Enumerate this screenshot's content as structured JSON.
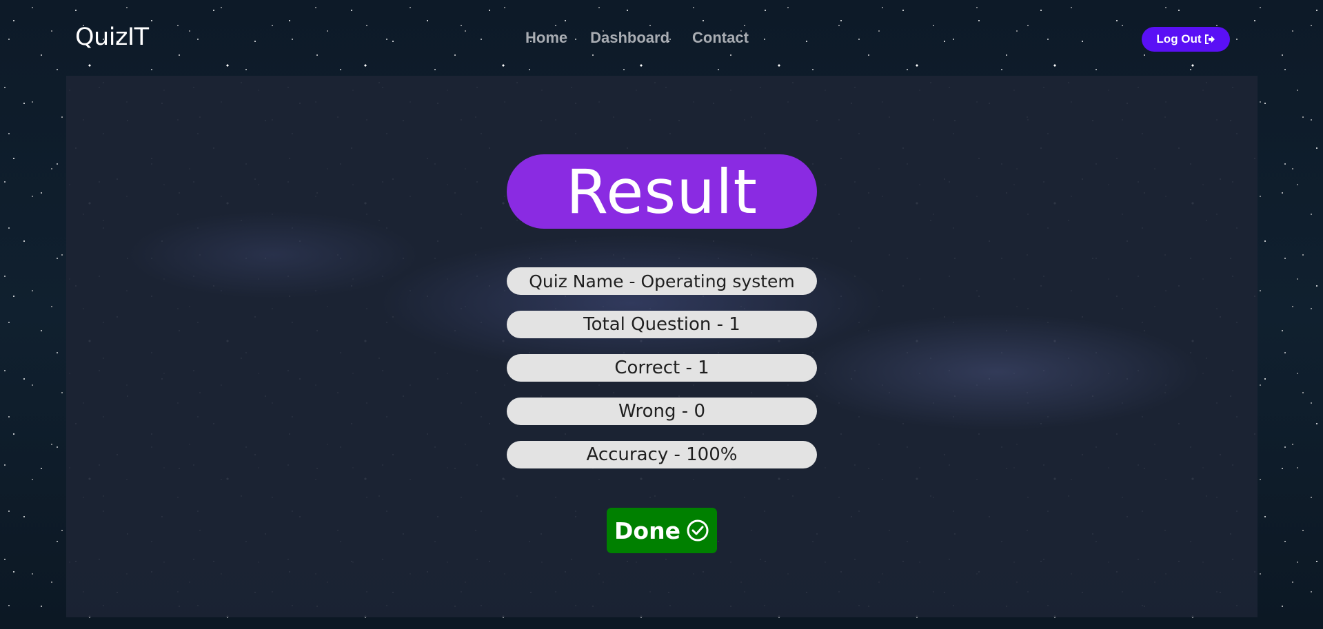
{
  "header": {
    "brand": "QuizIT",
    "nav": [
      {
        "label": "Home"
      },
      {
        "label": "Dashboard"
      },
      {
        "label": "Contact"
      }
    ],
    "logout_label": "Log Out",
    "logout_icon": "sign-out-icon"
  },
  "result": {
    "title": "Result",
    "stats": [
      {
        "label": "Quiz Name - Operating system"
      },
      {
        "label": "Total Question - 1"
      },
      {
        "label": "Correct - 1"
      },
      {
        "label": "Wrong - 0"
      },
      {
        "label": "Accuracy - 100%"
      }
    ],
    "done_label": "Done",
    "done_icon": "check-circle-icon"
  },
  "colors": {
    "result_pill": "#8a2be2",
    "logout_button": "#5a10f5",
    "done_button": "#008000",
    "stat_pill": "#e3e3e3"
  }
}
